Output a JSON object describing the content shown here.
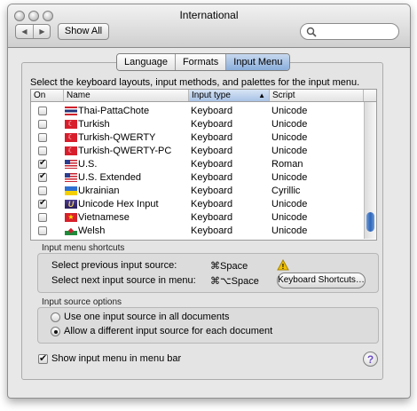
{
  "window": {
    "title": "International"
  },
  "toolbar": {
    "show_all_label": "Show All",
    "search_placeholder": ""
  },
  "tabs": [
    {
      "label": "Language",
      "active": false
    },
    {
      "label": "Formats",
      "active": false
    },
    {
      "label": "Input Menu",
      "active": true
    }
  ],
  "intro": "Select the keyboard layouts, input methods, and palettes for the input menu.",
  "table": {
    "headers": {
      "on": "On",
      "name": "Name",
      "input_type": "Input type",
      "script": "Script"
    },
    "rows": [
      {
        "on": false,
        "name": "Thai-PattaChote",
        "type": "Keyboard",
        "script": "Unicode",
        "flag": "thai-flag-icon"
      },
      {
        "on": false,
        "name": "Turkish",
        "type": "Keyboard",
        "script": "Unicode",
        "flag": "turkish-flag-icon"
      },
      {
        "on": false,
        "name": "Turkish-QWERTY",
        "type": "Keyboard",
        "script": "Unicode",
        "flag": "turkish-flag-icon"
      },
      {
        "on": false,
        "name": "Turkish-QWERTY-PC",
        "type": "Keyboard",
        "script": "Unicode",
        "flag": "turkish-flag-icon"
      },
      {
        "on": true,
        "name": "U.S.",
        "type": "Keyboard",
        "script": "Roman",
        "flag": "us-flag-icon"
      },
      {
        "on": true,
        "name": "U.S. Extended",
        "type": "Keyboard",
        "script": "Unicode",
        "flag": "us-flag-icon"
      },
      {
        "on": false,
        "name": "Ukrainian",
        "type": "Keyboard",
        "script": "Cyrillic",
        "flag": "ukrainian-flag-icon"
      },
      {
        "on": true,
        "name": "Unicode Hex Input",
        "type": "Keyboard",
        "script": "Unicode",
        "flag": "unicode-icon"
      },
      {
        "on": false,
        "name": "Vietnamese",
        "type": "Keyboard",
        "script": "Unicode",
        "flag": "vietnam-flag-icon"
      },
      {
        "on": false,
        "name": "Welsh",
        "type": "Keyboard",
        "script": "Unicode",
        "flag": "welsh-flag-icon"
      }
    ]
  },
  "shortcuts": {
    "title": "Input menu shortcuts",
    "prev_label": "Select previous input source:",
    "prev_key": "⌘Space",
    "next_label": "Select next input source in menu:",
    "next_key": "⌘⌥Space",
    "keyboard_shortcuts_button": "Keyboard Shortcuts…"
  },
  "options": {
    "title": "Input source options",
    "one_source": "Use one input source in all documents",
    "different_source": "Allow a different input source for each document",
    "selected": "different_source"
  },
  "show_menu": {
    "label": "Show input menu in menu bar",
    "checked": true
  },
  "help_label": "?"
}
